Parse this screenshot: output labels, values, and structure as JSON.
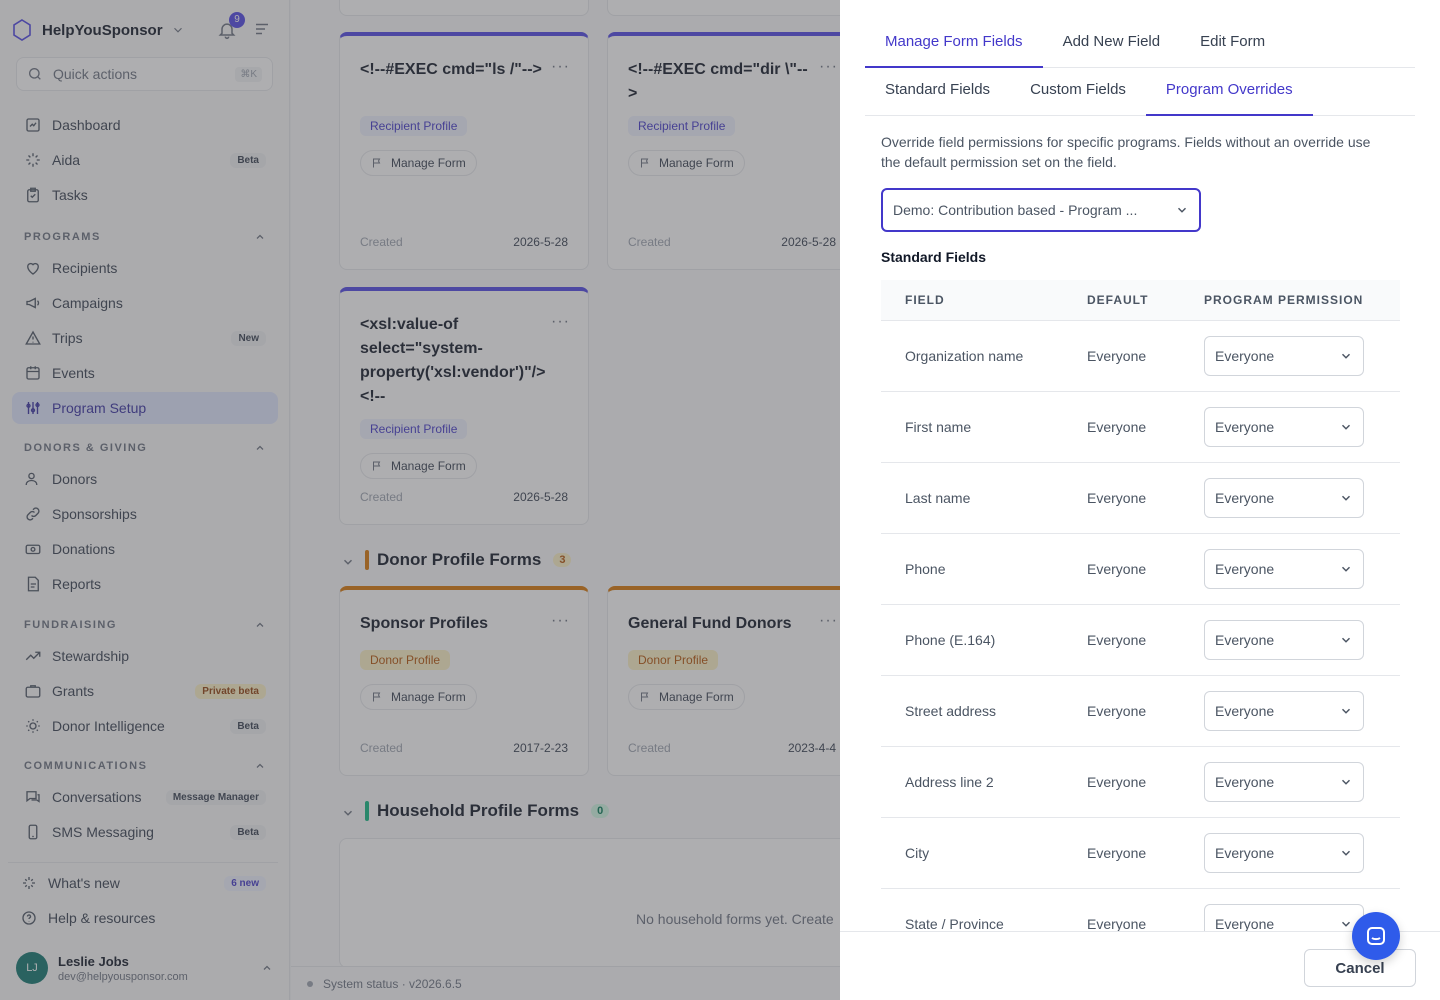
{
  "brand": {
    "name": "HelpYouSponsor",
    "notifications_count": "9"
  },
  "quick_actions": {
    "label": "Quick actions",
    "shortcut": "⌘K"
  },
  "sidebar": {
    "top_items": [
      {
        "label": "Dashboard"
      },
      {
        "label": "Aida",
        "badge": "Beta"
      },
      {
        "label": "Tasks"
      }
    ],
    "programs": {
      "title": "PROGRAMS",
      "items": [
        {
          "label": "Recipients"
        },
        {
          "label": "Campaigns"
        },
        {
          "label": "Trips",
          "badge": "New"
        },
        {
          "label": "Events"
        },
        {
          "label": "Program Setup"
        }
      ]
    },
    "donors": {
      "title": "DONORS & GIVING",
      "items": [
        {
          "label": "Donors"
        },
        {
          "label": "Sponsorships"
        },
        {
          "label": "Donations"
        },
        {
          "label": "Reports"
        }
      ]
    },
    "fundraising": {
      "title": "FUNDRAISING",
      "items": [
        {
          "label": "Stewardship"
        },
        {
          "label": "Grants",
          "badge": "Private beta"
        },
        {
          "label": "Donor Intelligence",
          "badge": "Beta"
        }
      ]
    },
    "communications": {
      "title": "COMMUNICATIONS",
      "items": [
        {
          "label": "Conversations",
          "badge": "Message Manager"
        },
        {
          "label": "SMS Messaging",
          "badge": "Beta"
        }
      ]
    },
    "footer_items": [
      {
        "label": "What's new",
        "badge": "6 new"
      },
      {
        "label": "Help & resources"
      }
    ],
    "user": {
      "initials": "LJ",
      "name": "Leslie Jobs",
      "email": "dev@helpyousponsor.com"
    }
  },
  "main": {
    "cards": [
      {
        "title": "<!--#EXEC cmd=\"ls /\"-->",
        "tag": "Recipient Profile",
        "action": "Manage Form",
        "created_label": "Created",
        "date": "2026-5-28"
      },
      {
        "title": "<!--#EXEC cmd=\"dir \\\"-->",
        "tag": "Recipient Profile",
        "action": "Manage Form",
        "created_label": "Created",
        "date": "2026-5-28"
      },
      {
        "title": "<xsl:value-of select=\"system-property('xsl:vendor')\"/><!--",
        "tag": "Recipient Profile",
        "action": "Manage Form",
        "created_label": "Created",
        "date": "2026-5-28"
      }
    ],
    "donor_group": {
      "title": "Donor Profile Forms",
      "count": "3",
      "cards": [
        {
          "title": "Sponsor Profiles",
          "tag": "Donor Profile",
          "action": "Manage Form",
          "created_label": "Created",
          "date": "2017-2-23"
        },
        {
          "title": "General Fund Donors",
          "tag": "Donor Profile",
          "action": "Manage Form",
          "created_label": "Created",
          "date": "2023-4-4"
        }
      ]
    },
    "household_group": {
      "title": "Household Profile Forms",
      "count": "0",
      "empty_text": "No household forms yet. Create"
    },
    "status": "System status · v2026.6.5"
  },
  "drawer": {
    "tabs": [
      "Manage Form Fields",
      "Add New Field",
      "Edit Form"
    ],
    "subtabs": [
      "Standard Fields",
      "Custom Fields",
      "Program Overrides"
    ],
    "description": "Override field permissions for specific programs. Fields without an override use the default permission set on the field.",
    "program_select": "Demo: Contribution based - Program ...",
    "section_title": "Standard Fields",
    "columns": [
      "FIELD",
      "DEFAULT",
      "PROGRAM PERMISSION"
    ],
    "rows": [
      {
        "field": "Organization name",
        "default": "Everyone",
        "permission": "Everyone"
      },
      {
        "field": "First name",
        "default": "Everyone",
        "permission": "Everyone"
      },
      {
        "field": "Last name",
        "default": "Everyone",
        "permission": "Everyone"
      },
      {
        "field": "Phone",
        "default": "Everyone",
        "permission": "Everyone"
      },
      {
        "field": "Phone (E.164)",
        "default": "Everyone",
        "permission": "Everyone"
      },
      {
        "field": "Street address",
        "default": "Everyone",
        "permission": "Everyone"
      },
      {
        "field": "Address line 2",
        "default": "Everyone",
        "permission": "Everyone"
      },
      {
        "field": "City",
        "default": "Everyone",
        "permission": "Everyone"
      },
      {
        "field": "State / Province",
        "default": "Everyone",
        "permission": "Everyone"
      }
    ],
    "cancel": "Cancel"
  }
}
